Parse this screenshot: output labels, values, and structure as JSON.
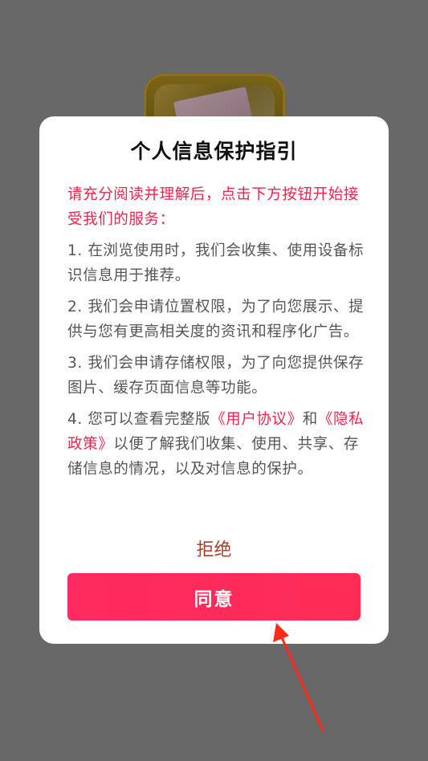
{
  "dialog": {
    "title": "个人信息保护指引",
    "intro": "请充分阅读并理解后，点击下方按钮开始接受我们的服务：",
    "items": [
      "1. 在浏览使用时，我们会收集、使用设备标识信息用于推荐。",
      "2. 我们会申请位置权限，为了向您展示、提供与您有更高相关度的资讯和程序化广告。",
      "3. 我们会申请存储权限，为了向您提供保存图片、缓存页面信息等功能。"
    ],
    "item4": {
      "prefix": "4. 您可以查看完整版",
      "user_agreement": "《用户协议》",
      "and": "和",
      "privacy_policy": "《隐私政策》",
      "suffix": "以便了解我们收集、使用、共享、存储信息的情况，以及对信息的保护。"
    },
    "reject_label": "拒绝",
    "agree_label": "同意"
  },
  "colors": {
    "accent": "#fe2c55",
    "link": "#e8254e",
    "reject": "#a0422f",
    "overlay": "#686868",
    "annotation_arrow": "#ff2a1a"
  },
  "icons": {
    "background_app": "app-icon",
    "annotation": "red-arrow-icon"
  }
}
